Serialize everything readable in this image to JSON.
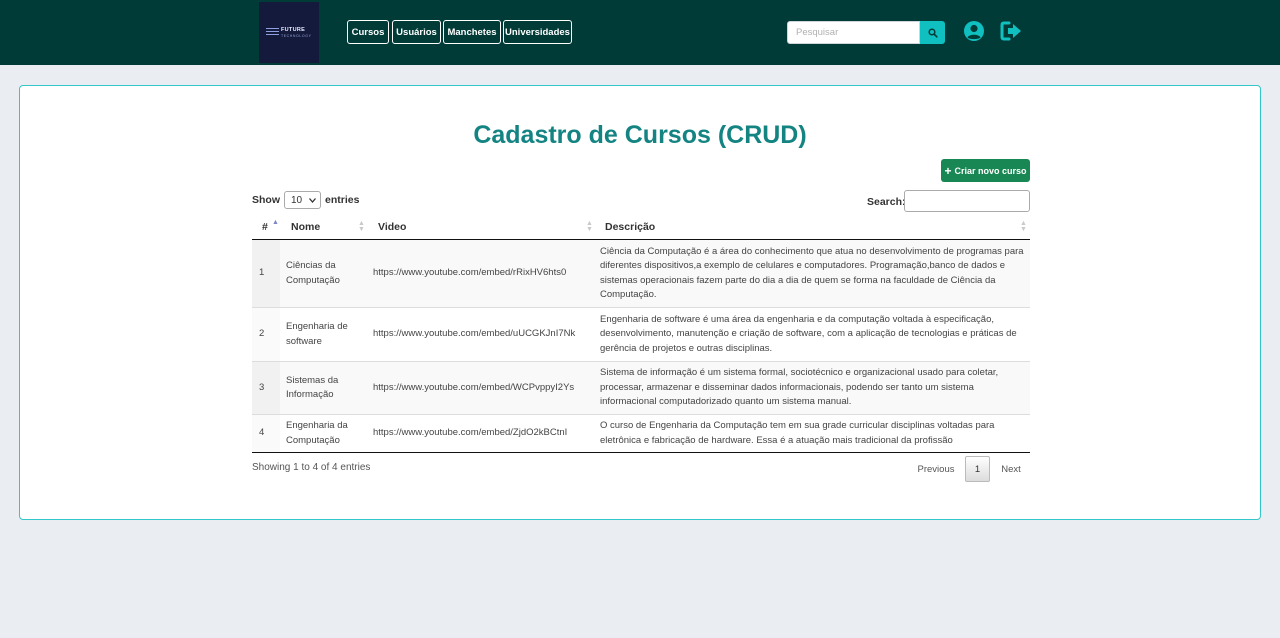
{
  "navbar": {
    "logo": {
      "text": "FUTURE",
      "subtext": "TECHNOLOGY"
    },
    "links": [
      "Cursos",
      "Usuários",
      "Manchetes",
      "Universidades"
    ],
    "search_placeholder": "Pesquisar",
    "icons": [
      "search-icon",
      "user-circle-icon",
      "logout-icon"
    ],
    "colors": {
      "background": "#003b38",
      "search_button": "#10bfc0"
    }
  },
  "page": {
    "title": "Cadastro de Cursos (CRUD)",
    "create_button": "Criar novo curso",
    "colors": {
      "title": "#138482",
      "create_button": "#198754",
      "card_border": "#33c7c9"
    }
  },
  "table_controls": {
    "show_label": "Show",
    "entries_value": "10",
    "entries_label": "entries",
    "search_label": "Search:"
  },
  "table": {
    "columns": [
      "#",
      "Nome",
      "Video",
      "Descrição"
    ],
    "rows": [
      {
        "id": "1",
        "nome": "Ciências da Computação",
        "video": "https://www.youtube.com/embed/rRixHV6hts0",
        "descricao": "Ciência da Computação é a área do conhecimento que atua no desenvolvimento de programas para diferentes dispositivos,a exemplo de celulares e computadores. Programação,banco de dados e sistemas operacionais fazem parte do dia a dia de quem se forma na faculdade de Ciência da Computação."
      },
      {
        "id": "2",
        "nome": "Engenharia de software",
        "video": "https://www.youtube.com/embed/uUCGKJnI7Nk",
        "descricao": "Engenharia de software é uma área da engenharia e da computação voltada à especificação, desenvolvimento, manutenção e criação de software, com a aplicação de tecnologias e práticas de gerência de projetos e outras disciplinas."
      },
      {
        "id": "3",
        "nome": "Sistemas da Informação",
        "video": "https://www.youtube.com/embed/WCPvppyI2Ys",
        "descricao": "Sistema de informação é um sistema formal, sociotécnico e organizacional usado para coletar, processar, armazenar e disseminar dados informacionais, podendo ser tanto um sistema informacional computadorizado quanto um sistema manual."
      },
      {
        "id": "4",
        "nome": "Engenharia da Computação",
        "video": "https://www.youtube.com/embed/ZjdO2kBCtnI",
        "descricao": "O curso de Engenharia da Computação tem em sua grade curricular disciplinas voltadas para eletrônica e fabricação de hardware. Essa é a atuação mais tradicional da profissão"
      }
    ]
  },
  "footer": {
    "info": "Showing 1 to 4 of 4 entries",
    "previous": "Previous",
    "current_page": "1",
    "next": "Next"
  }
}
